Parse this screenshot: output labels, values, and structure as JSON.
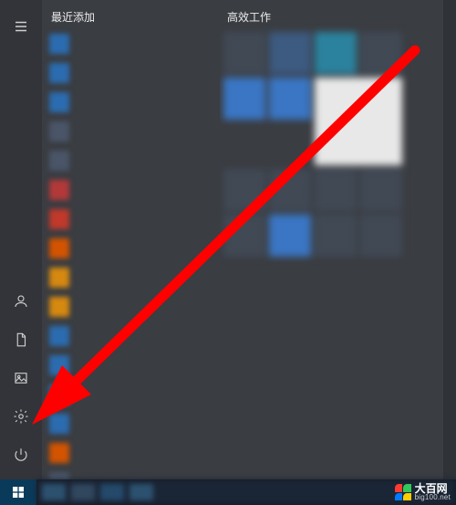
{
  "rail": {
    "menu_tooltip": "展开",
    "user_tooltip": "用户",
    "documents_tooltip": "文档",
    "pictures_tooltip": "图片",
    "settings_tooltip": "设置",
    "power_tooltip": "电源"
  },
  "app_list": {
    "heading": "最近添加",
    "items": [
      {
        "label": "",
        "color": "#2b6cb0"
      },
      {
        "label": "",
        "color": "#2b6cb0"
      },
      {
        "label": "",
        "color": "#2b6cb0"
      },
      {
        "label": "",
        "color": "#4a5568"
      },
      {
        "label": "",
        "color": "#4a5568"
      },
      {
        "label": "",
        "color": "#b33939"
      },
      {
        "label": "",
        "color": "#c0392b"
      },
      {
        "label": "",
        "color": "#d35400"
      },
      {
        "label": "",
        "color": "#d68910"
      },
      {
        "label": "",
        "color": "#d68910"
      },
      {
        "label": "",
        "color": "#2b6cb0"
      },
      {
        "label": "",
        "color": "#2b6cb0"
      },
      {
        "label": "",
        "color": "#2b6cb0"
      },
      {
        "label": "",
        "color": "#2b6cb0"
      },
      {
        "label": "",
        "color": "#d35400"
      },
      {
        "label": "",
        "color": "#4a5568"
      }
    ]
  },
  "tiles": {
    "heading": "高效工作",
    "items": [
      {
        "size": "small",
        "color": "#414955"
      },
      {
        "size": "small",
        "color": "#3d5a80"
      },
      {
        "size": "small",
        "color": "#2b829e"
      },
      {
        "size": "small",
        "color": "#414955"
      },
      {
        "size": "small",
        "color": "#3a76c4"
      },
      {
        "size": "small",
        "color": "#3a76c4"
      },
      {
        "size": "med",
        "color": "#e8e8e8"
      },
      {
        "size": "small",
        "color": "#414955"
      },
      {
        "size": "small",
        "color": "#414955"
      },
      {
        "size": "small",
        "color": "#414955"
      },
      {
        "size": "small",
        "color": "#414955"
      },
      {
        "size": "small",
        "color": "#414955"
      },
      {
        "size": "small",
        "color": "#3a76c4"
      },
      {
        "size": "small",
        "color": "#414955"
      },
      {
        "size": "small",
        "color": "#414955"
      }
    ]
  },
  "taskbar": {
    "start_tooltip": "开始"
  },
  "watermark": {
    "cn": "大百网",
    "en": "big100.net"
  },
  "annotation": {
    "target": "settings-button"
  }
}
